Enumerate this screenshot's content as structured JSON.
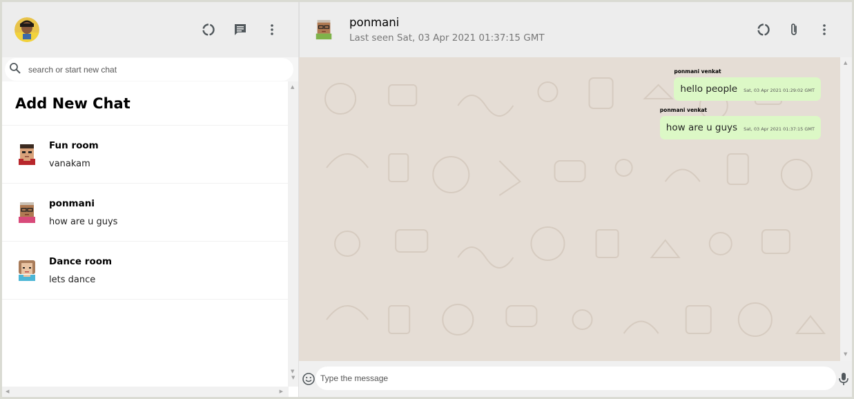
{
  "sidebar": {
    "search_placeholder": "search or start new chat",
    "add_chat_label": "Add New Chat",
    "chats": [
      {
        "name": "Fun room",
        "last_message": "vanakam",
        "avatar": "boy-avatar"
      },
      {
        "name": "ponmani",
        "last_message": "how are u guys",
        "avatar": "glasses-avatar"
      },
      {
        "name": "Dance room",
        "last_message": "lets dance",
        "avatar": "girl-avatar"
      }
    ]
  },
  "chat": {
    "contact_name": "ponmani",
    "last_seen": "Last seen Sat, 03 Apr 2021 01:37:15 GMT",
    "messages": [
      {
        "sender": "ponmani venkat",
        "text": "hello people",
        "timestamp": "Sat, 03 Apr 2021 01:29:02 GMT"
      },
      {
        "sender": "ponmani venkat",
        "text": "how are u guys",
        "timestamp": "Sat, 03 Apr 2021 01:37:15 GMT"
      }
    ],
    "input_placeholder": "Type the message"
  },
  "icons": {
    "status": "status-icon",
    "new_chat": "chat-icon",
    "menu": "more-vert-icon",
    "attach": "attach-icon",
    "emoji": "emoji-icon",
    "mic": "mic-icon",
    "search": "search-icon"
  },
  "colors": {
    "header_bg": "#ededed",
    "chat_bg": "#e5ddd5",
    "bubble_sent": "#dcf8c6",
    "icon": "#51585c"
  }
}
